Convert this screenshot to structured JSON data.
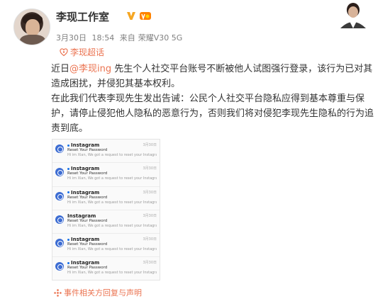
{
  "post": {
    "author": "李现工作室",
    "meta": {
      "date": "3月30日",
      "time": "18:54",
      "source_prefix": "来自",
      "device": "荣耀V30 5G"
    },
    "topic_tag": "李现超话",
    "paragraph1_before": "近日",
    "mention": "@李现ing",
    "paragraph1_after": " 先生个人社交平台账号不断被他人试图强行登录，该行为已对其造成困扰，并侵犯其基本权利。",
    "paragraph2": "在此我们代表李现先生发出告诫：公民个人社交平台隐私应得到基本尊重与保护，请停止侵犯他人隐私的恶意行为，否则我们将对侵犯李现先生隐私的行为追责到底。",
    "footer_link": "事件相关方回复与声明"
  },
  "emails": [
    {
      "from": "Instagram",
      "subject": "Reset Your Password",
      "preview": "Hi im Xian, We got a request to reset your Instagram password. Reset Password. If you ignore",
      "date": "3月30日",
      "unread": true
    },
    {
      "from": "Instagram",
      "subject": "Reset Your Password",
      "preview": "Hi im Xian, We got a request to reset your Instagram password. Reset Password. If you ignore",
      "date": "3月30日",
      "unread": true
    },
    {
      "from": "Instagram",
      "subject": "Reset Your Password",
      "preview": "Hi im Xian, We got a request to reset your Instagram password. Reset Password. If you ignore",
      "date": "3月30日",
      "unread": true
    },
    {
      "from": "Instagram",
      "subject": "Reset Your Password",
      "preview": "Hi im Xian, We got a request to reset your Instagram password. Reset Password. If you ignore",
      "date": "3月30日",
      "unread": false
    },
    {
      "from": "Instagram",
      "subject": "Reset Your Password",
      "preview": "Hi im Xian, We got a request to reset your Instagram password. Reset Password. If you ignore",
      "date": "3月30日",
      "unread": true
    },
    {
      "from": "Instagram",
      "subject": "Reset Your Password",
      "preview": "Hi im Xian, We got a request to reset your Instagram password. Reset Password. If you ignore",
      "date": "3月30日",
      "unread": true
    }
  ],
  "colors": {
    "accent": "#eb7350",
    "verified": "#ffa500",
    "vip": "#f5a623"
  },
  "icons": {
    "verified": "verified-v-icon",
    "vip": "vip-level-icon",
    "topic": "super-topic-icon",
    "link": "link-icon"
  }
}
